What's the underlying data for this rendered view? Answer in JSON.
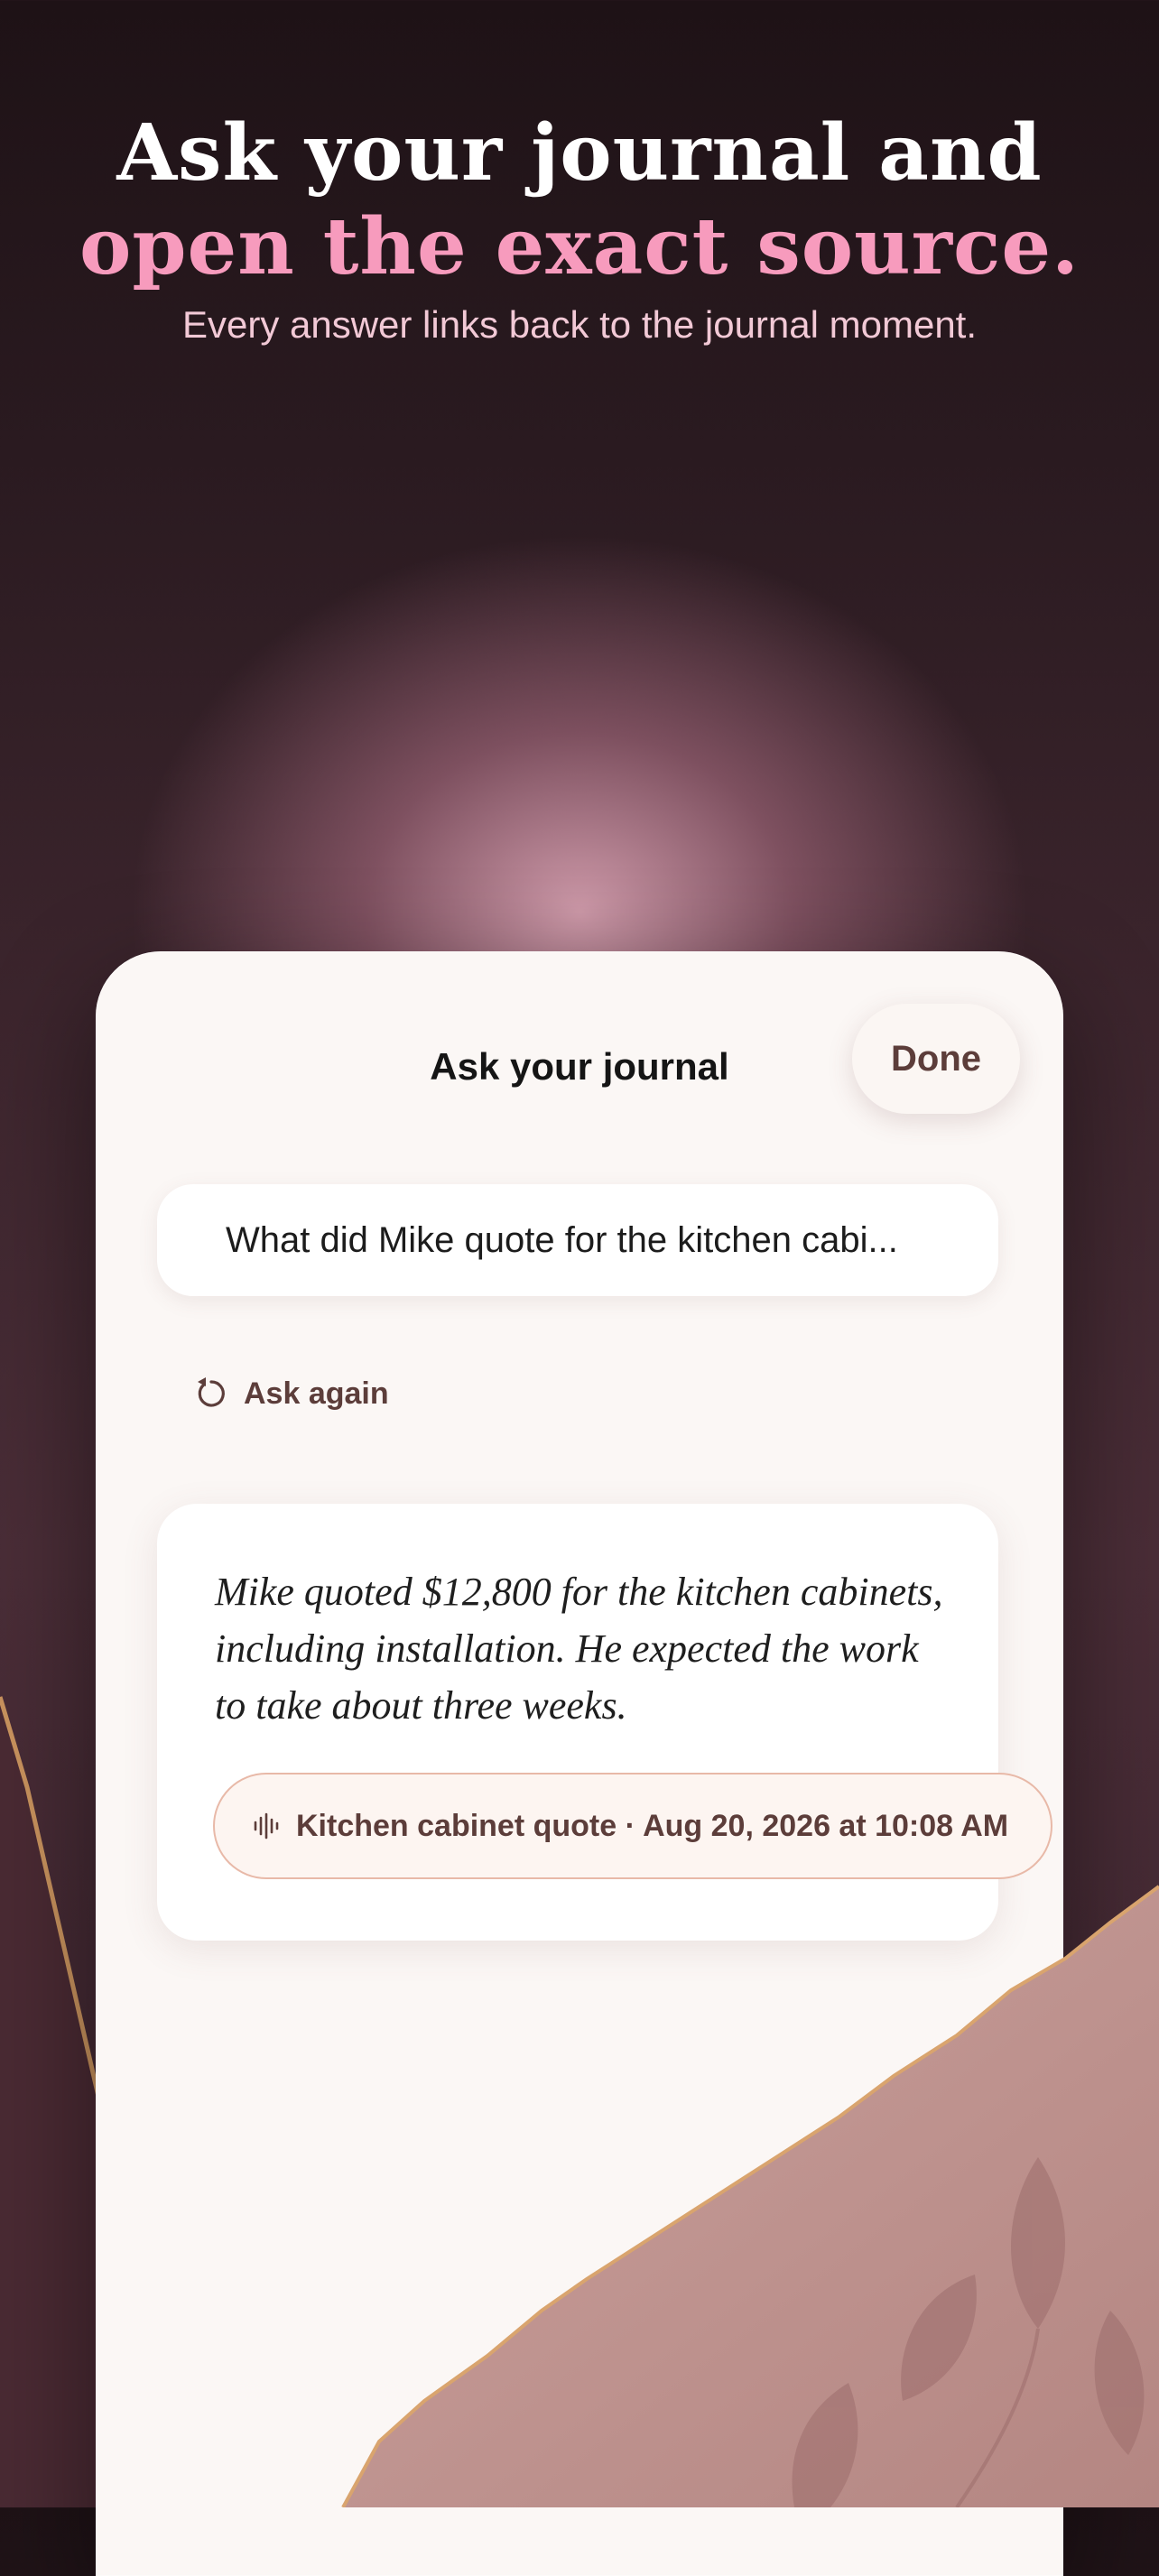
{
  "headline": {
    "line1": "Ask your journal and",
    "line2": "open the exact source.",
    "subtitle": "Every answer links back to the journal moment."
  },
  "sheet": {
    "title": "Ask your journal",
    "done_label": "Done",
    "query": "What did Mike quote for the kitchen cabi...",
    "ask_again_label": "Ask again",
    "ask_again_icon": "refresh-icon",
    "answer": "Mike quoted $12,800 for the kitchen cabinets, including installation. He expected the work to take about three weeks.",
    "source_label": "Kitchen cabinet quote · Aug 20, 2026 at 10:08 AM",
    "source_icon": "waveform-icon"
  },
  "colors": {
    "accent_pink": "#f79bbd",
    "card_bg": "#fbf7f5",
    "brown_text": "#5c3d3a",
    "gold_edge": "#c9935e"
  }
}
